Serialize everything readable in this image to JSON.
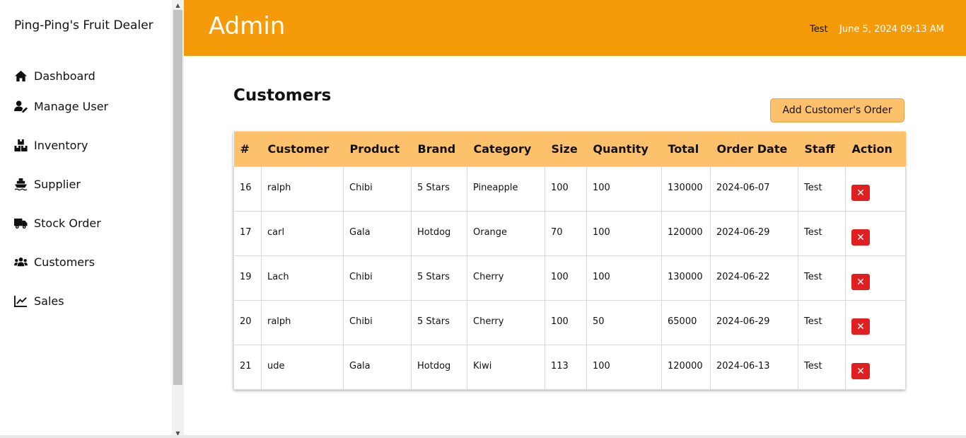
{
  "sidebar": {
    "brand": "Ping-Ping's Fruit Dealer",
    "items": [
      {
        "label": "Dashboard",
        "icon": "home-icon"
      },
      {
        "label": "Manage User",
        "icon": "user-edit-icon"
      },
      {
        "label": "Inventory",
        "icon": "boxes-icon"
      },
      {
        "label": "Supplier",
        "icon": "ship-icon"
      },
      {
        "label": "Stock Order",
        "icon": "truck-icon"
      },
      {
        "label": "Customers",
        "icon": "users-icon"
      },
      {
        "label": "Sales",
        "icon": "chart-line-icon"
      }
    ]
  },
  "header": {
    "title": "Admin",
    "user": "Test",
    "datetime": "June 5, 2024 09:13 AM",
    "color": "#f59a08"
  },
  "main": {
    "title": "Customers",
    "add_button": "Add Customer's Order",
    "table": {
      "columns": [
        "#",
        "Customer",
        "Product",
        "Brand",
        "Category",
        "Size",
        "Quantity",
        "Total",
        "Order Date",
        "Staff",
        "Action"
      ],
      "rows": [
        [
          "16",
          "ralph",
          "Chibi",
          "5 Stars",
          "Pineapple",
          "100",
          "100",
          "130000",
          "2024-06-07",
          "Test"
        ],
        [
          "17",
          "carl",
          "Gala",
          "Hotdog",
          "Orange",
          "70",
          "100",
          "120000",
          "2024-06-29",
          "Test"
        ],
        [
          "19",
          "Lach",
          "Chibi",
          "5 Stars",
          "Cherry",
          "100",
          "100",
          "130000",
          "2024-06-22",
          "Test"
        ],
        [
          "20",
          "ralph",
          "Chibi",
          "5 Stars",
          "Cherry",
          "100",
          "50",
          "65000",
          "2024-06-29",
          "Test"
        ],
        [
          "21",
          "ude",
          "Gala",
          "Hotdog",
          "Kiwi",
          "113",
          "100",
          "120000",
          "2024-06-13",
          "Test"
        ]
      ],
      "delete_icon": "close-icon",
      "delete_glyph": "✕"
    }
  }
}
